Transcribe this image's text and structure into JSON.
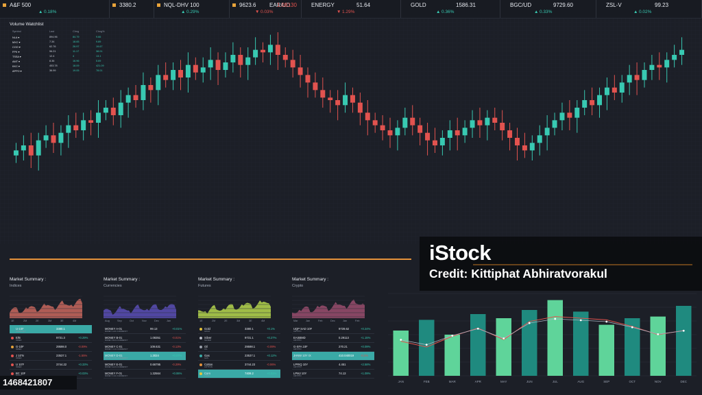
{
  "ticker": [
    {
      "name": "A&F 500",
      "dot": true,
      "value": "",
      "chg": "0.18%",
      "chg_dir": "up"
    },
    {
      "name": "3380.2",
      "dot": true,
      "value": "",
      "chg": "",
      "chg_dir": "up"
    },
    {
      "name": "NQL-DHV 100",
      "dot": true,
      "value": "",
      "chg": "0.29%",
      "chg_dir": "up"
    },
    {
      "name": "9623.6",
      "dot": true,
      "value": "EAR/UD",
      "extra": "1.08130",
      "chg": "0.03%",
      "chg_dir": "dn"
    },
    {
      "name": "ENERGY",
      "dot": false,
      "value": "51.64",
      "chg": "1.29%",
      "chg_dir": "dn"
    },
    {
      "name": "GOLD",
      "dot": false,
      "value": "1586.31",
      "chg": "0.36%",
      "chg_dir": "up"
    },
    {
      "name": "BGC/UD",
      "dot": false,
      "value": "9729.60",
      "chg": "0.33%",
      "chg_dir": "up"
    },
    {
      "name": "ZSL-V",
      "dot": false,
      "value": "99.23",
      "chg": "0.02%",
      "chg_dir": "up"
    }
  ],
  "watchlist": {
    "title": "Volume Watchlist",
    "headers": [
      "Symbol",
      "Last",
      "Chng",
      "Chng%"
    ],
    "rows": [
      [
        "NLA ▾",
        "894.96",
        "84.79",
        "9.66"
      ],
      [
        "MXC ▾",
        "7.34",
        "18.65",
        "9.89"
      ],
      [
        "COO ▾",
        "62.76",
        "26.97",
        "19.67"
      ],
      [
        "FPK ▾",
        "96.21",
        "11.17",
        "38.01"
      ],
      [
        "TSSA ▾",
        "12.4",
        "4",
        "13.1"
      ],
      [
        "AMT ▾",
        "8.36",
        "16.96",
        "5.69"
      ],
      [
        "KKC ▾",
        "453.78",
        "18.09",
        "421.09"
      ],
      [
        "APPO ▾",
        "36.99",
        "19.05",
        "78.01"
      ]
    ]
  },
  "colors": {
    "up": "#38c9b2",
    "down": "#e2534f",
    "accent": "#e6923a",
    "background": "#1c1f27"
  },
  "panels": [
    {
      "title": "Market Summary :",
      "subtitle": "Indices",
      "area_color": "#c9675e",
      "xticks": [
        "1E",
        "2M",
        "2E",
        "3M",
        "3E",
        "4M"
      ],
      "rows": [
        {
          "name": "U-10F",
          "sub": "INDEX/QLT",
          "val": "3380.1",
          "chg": "",
          "hl": true,
          "dot": "#3aa9a6"
        },
        {
          "name": "E/B",
          "sub": "INDEX",
          "val": "9731.3",
          "chg": "+0.29%",
          "hl": false,
          "dot": "#e2534f"
        },
        {
          "name": "G-10F",
          "sub": "INDEX",
          "val": "29598.0",
          "chg": "-0.09%",
          "hl": false,
          "dot": "#e6a33a"
        },
        {
          "name": "J 10'N",
          "sub": "INDEX",
          "val": "23537.1",
          "chg": "-1.55%",
          "hl": false,
          "dot": "#e2534f"
        },
        {
          "name": "U 10'F",
          "sub": "INDEX",
          "val": "3744.22",
          "chg": "+0.33%",
          "hl": false,
          "dot": "#e2534f"
        },
        {
          "name": "BC 10F",
          "sub": "INDEX",
          "val": "",
          "chg": "+0.03%",
          "hl": false,
          "dot": "#e2534f"
        }
      ]
    },
    {
      "title": "Market Summary :",
      "subtitle": "Currencies",
      "area_color": "#5a4fb8",
      "xticks": [
        "Aug",
        "Sep",
        "Oct",
        "Nov",
        "Dec",
        "Jan"
      ],
      "rows": [
        {
          "name": "MONEY A-01",
          "sub": "MONEY A-01 CURRENCY",
          "val": "99.13",
          "chg": "+0.01%",
          "hl": false,
          "dot": ""
        },
        {
          "name": "MONEY B-01",
          "sub": "MONEY B-01 CURRENCY",
          "val": "1.08351",
          "chg": "-0.01%",
          "hl": false,
          "dot": ""
        },
        {
          "name": "MONEY C-01",
          "sub": "MONEY C-01 CURRENCY",
          "val": "109.631",
          "chg": "-0.13%",
          "hl": false,
          "dot": ""
        },
        {
          "name": "MONEY D-01",
          "sub": "MONEY D-01 CURRENCY",
          "val": "1.3024",
          "chg": "+0.07%",
          "hl": true,
          "dot": ""
        },
        {
          "name": "MONEY E-01",
          "sub": "MONEY E-01 CURRENCY",
          "val": "0.66795",
          "chg": "-0.29%",
          "hl": false,
          "dot": ""
        },
        {
          "name": "MONEY F-01",
          "sub": "MONEY F-01 CURRENCY",
          "val": "1.32564",
          "chg": "+0.06%",
          "hl": false,
          "dot": ""
        }
      ]
    },
    {
      "title": "Market Summary :",
      "subtitle": "Futures",
      "area_color": "#b6d84e",
      "xticks": [
        "1E",
        "2M",
        "2E",
        "3M",
        "3E",
        "4M"
      ],
      "rows": [
        {
          "name": "Gold",
          "sub": "GOLD",
          "val": "3380.1",
          "chg": "+0.1%",
          "hl": false,
          "dot": "#e6c33a"
        },
        {
          "name": "Silver",
          "sub": "SILVER",
          "val": "9731.1",
          "chg": "+0.27%",
          "hl": false,
          "dot": "#b8bcc6"
        },
        {
          "name": "Oil",
          "sub": "OIL",
          "val": "29598.1",
          "chg": "-0.09%",
          "hl": false,
          "dot": "#9aa0ab"
        },
        {
          "name": "Gas",
          "sub": "GAS",
          "val": "23537.1",
          "chg": "+0.12%",
          "hl": false,
          "dot": "#3aa9a6"
        },
        {
          "name": "Cotton",
          "sub": "COTTON",
          "val": "3744.23",
          "chg": "-0.06%",
          "hl": false,
          "dot": "#e6923a"
        },
        {
          "name": "Corn",
          "sub": "CORN",
          "val": "7409.2",
          "chg": "+0.01%",
          "hl": true,
          "dot": "#e6c33a"
        }
      ]
    },
    {
      "title": "Market Summary :",
      "subtitle": "Crypto",
      "area_color": "#9a4d6e",
      "xticks": [
        "Mar",
        "Jan",
        "Feb",
        "Dec",
        "Jan",
        "Feb"
      ],
      "rows": [
        {
          "name": "UQP SAD 10F",
          "sub": "CRYPTO",
          "val": "9728.62",
          "chg": "+0.24%",
          "hl": false,
          "dot": ""
        },
        {
          "name": "EASBMD",
          "sub": "CRYPTO",
          "val": "0.29113",
          "chg": "+1.15%",
          "hl": false,
          "dot": ""
        },
        {
          "name": "G-SFA 10F",
          "sub": "CRYPTO",
          "val": "270.21",
          "chg": "+0.09%",
          "hl": false,
          "dot": ""
        },
        {
          "name": "JHNW 10Y IX",
          "sub": "CRYPTO",
          "val": "410.040019",
          "chg": "-0.2%",
          "hl": true,
          "dot": ""
        },
        {
          "name": "LPRIQ 10Y",
          "sub": "CRYPTO",
          "val": "4.451",
          "chg": "+2.58%",
          "hl": false,
          "dot": ""
        },
        {
          "name": "LPMJ 10Y",
          "sub": "CRYPTO",
          "val": "74.13",
          "chg": "+1.09%",
          "hl": false,
          "dot": ""
        }
      ]
    }
  ],
  "chart_data": [
    {
      "type": "candlestick",
      "title": "",
      "grid": true,
      "values": [
        40,
        42,
        38,
        44,
        46,
        43,
        47,
        50,
        48,
        52,
        51,
        55,
        57,
        54,
        59,
        62,
        60,
        66,
        64,
        70,
        68,
        72,
        69,
        74,
        71,
        73,
        76,
        72,
        75,
        78,
        74,
        77,
        80,
        79,
        82,
        78,
        76,
        73,
        70,
        67,
        64,
        61,
        60,
        58,
        62,
        59,
        55,
        52,
        50,
        48,
        46,
        49,
        53,
        50,
        47,
        44,
        42,
        45,
        48,
        46,
        49,
        52,
        50,
        53,
        51,
        48,
        45,
        42,
        40,
        43,
        46,
        49,
        52,
        55,
        53,
        57,
        60,
        58,
        62,
        65,
        63,
        67,
        70,
        68,
        72,
        74,
        73,
        76,
        78,
        80
      ],
      "ylim": [
        30,
        90
      ]
    },
    {
      "type": "bar",
      "title": "",
      "categories": [
        "JAN",
        "FEB",
        "MAR",
        "APR",
        "MAY",
        "JUN",
        "JUL",
        "AUG",
        "SEP",
        "OCT",
        "NOV",
        "DEC"
      ],
      "values": [
        55,
        68,
        50,
        75,
        70,
        80,
        92,
        78,
        62,
        70,
        72,
        85
      ],
      "line_values": [
        42,
        35,
        48,
        58,
        44,
        66,
        72,
        70,
        68,
        60,
        50,
        55
      ],
      "ylim": [
        0,
        100
      ],
      "grid": true
    }
  ],
  "watermark": {
    "logo": "iStock",
    "credit": "Credit: Kittiphat Abhiratvorakul",
    "id": "1468421807"
  }
}
